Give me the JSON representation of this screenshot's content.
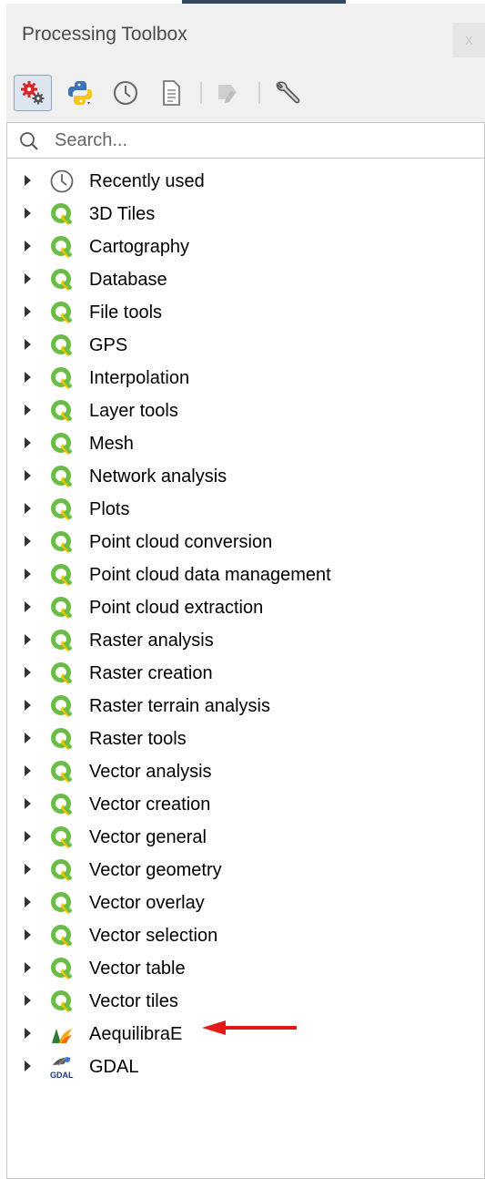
{
  "panel": {
    "title": "Processing Toolbox",
    "close_label": "x"
  },
  "search": {
    "placeholder": "Search..."
  },
  "tree": {
    "items": [
      {
        "label": "Recently used",
        "icon": "clock-icon"
      },
      {
        "label": "3D Tiles",
        "icon": "qgis-icon"
      },
      {
        "label": "Cartography",
        "icon": "qgis-icon"
      },
      {
        "label": "Database",
        "icon": "qgis-icon"
      },
      {
        "label": "File tools",
        "icon": "qgis-icon"
      },
      {
        "label": "GPS",
        "icon": "qgis-icon"
      },
      {
        "label": "Interpolation",
        "icon": "qgis-icon"
      },
      {
        "label": "Layer tools",
        "icon": "qgis-icon"
      },
      {
        "label": "Mesh",
        "icon": "qgis-icon"
      },
      {
        "label": "Network analysis",
        "icon": "qgis-icon"
      },
      {
        "label": "Plots",
        "icon": "qgis-icon"
      },
      {
        "label": "Point cloud conversion",
        "icon": "qgis-icon"
      },
      {
        "label": "Point cloud data management",
        "icon": "qgis-icon"
      },
      {
        "label": "Point cloud extraction",
        "icon": "qgis-icon"
      },
      {
        "label": "Raster analysis",
        "icon": "qgis-icon"
      },
      {
        "label": "Raster creation",
        "icon": "qgis-icon"
      },
      {
        "label": "Raster terrain analysis",
        "icon": "qgis-icon"
      },
      {
        "label": "Raster tools",
        "icon": "qgis-icon"
      },
      {
        "label": "Vector analysis",
        "icon": "qgis-icon"
      },
      {
        "label": "Vector creation",
        "icon": "qgis-icon"
      },
      {
        "label": "Vector general",
        "icon": "qgis-icon"
      },
      {
        "label": "Vector geometry",
        "icon": "qgis-icon"
      },
      {
        "label": "Vector overlay",
        "icon": "qgis-icon"
      },
      {
        "label": "Vector selection",
        "icon": "qgis-icon"
      },
      {
        "label": "Vector table",
        "icon": "qgis-icon"
      },
      {
        "label": "Vector tiles",
        "icon": "qgis-icon"
      },
      {
        "label": "AequilibraE",
        "icon": "aequilibrae-icon"
      },
      {
        "label": "GDAL",
        "icon": "gdal-icon",
        "icon_text": "GDAL"
      }
    ]
  },
  "colors": {
    "qgis_green": "#6abd45",
    "annotation_arrow": "#e31a1a"
  }
}
